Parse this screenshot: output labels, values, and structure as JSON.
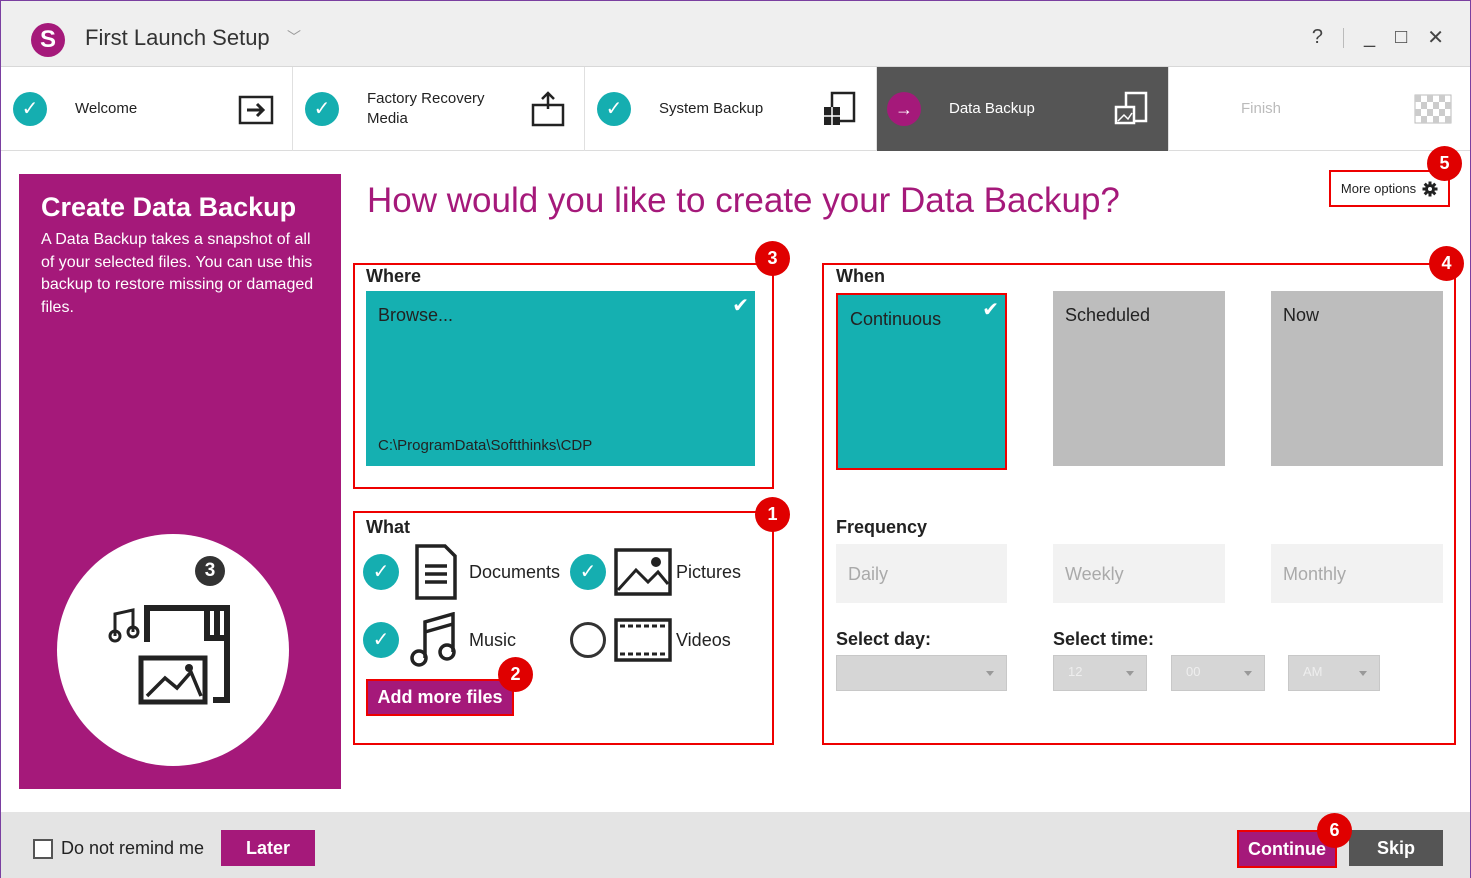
{
  "window": {
    "title": "First Launch Setup"
  },
  "controls": {
    "help": "?",
    "minimize": "_",
    "maximize": "□",
    "close": "✕"
  },
  "steps": [
    {
      "label": "Welcome",
      "state": "done"
    },
    {
      "label": "Factory Recovery Media",
      "state": "done"
    },
    {
      "label": "System Backup",
      "state": "done"
    },
    {
      "label": "Data Backup",
      "state": "active"
    },
    {
      "label": "Finish",
      "state": "pending"
    }
  ],
  "left_panel": {
    "title": "Create Data Backup",
    "description": "A Data Backup takes a snapshot of all of your selected files. You can use this backup to restore missing or damaged files.",
    "badge": "3"
  },
  "heading": "How would you like to create your Data Backup?",
  "more_options": "More options",
  "where": {
    "label": "Where",
    "tile_label": "Browse...",
    "path": "C:\\ProgramData\\Softthinks\\CDP"
  },
  "what": {
    "label": "What",
    "items": [
      {
        "label": "Documents",
        "checked": true
      },
      {
        "label": "Pictures",
        "checked": true
      },
      {
        "label": "Music",
        "checked": true
      },
      {
        "label": "Videos",
        "checked": false
      }
    ],
    "add_button": "Add more files"
  },
  "when": {
    "label": "When",
    "options": [
      {
        "label": "Continuous",
        "selected": true
      },
      {
        "label": "Scheduled",
        "selected": false
      },
      {
        "label": "Now",
        "selected": false
      }
    ]
  },
  "frequency": {
    "label": "Frequency",
    "options": [
      "Daily",
      "Weekly",
      "Monthly"
    ]
  },
  "select_day": {
    "label": "Select day:",
    "value": ""
  },
  "select_time": {
    "label": "Select time:",
    "hour": "12",
    "minute": "00",
    "ampm": "AM"
  },
  "annotations": [
    "1",
    "2",
    "3",
    "4",
    "5",
    "6"
  ],
  "footer": {
    "do_not_remind": "Do not remind me",
    "later": "Later",
    "continue": "Continue",
    "skip": "Skip"
  },
  "colors": {
    "accent": "#a5197a",
    "teal": "#15b0b1",
    "annotation": "#e00000"
  }
}
